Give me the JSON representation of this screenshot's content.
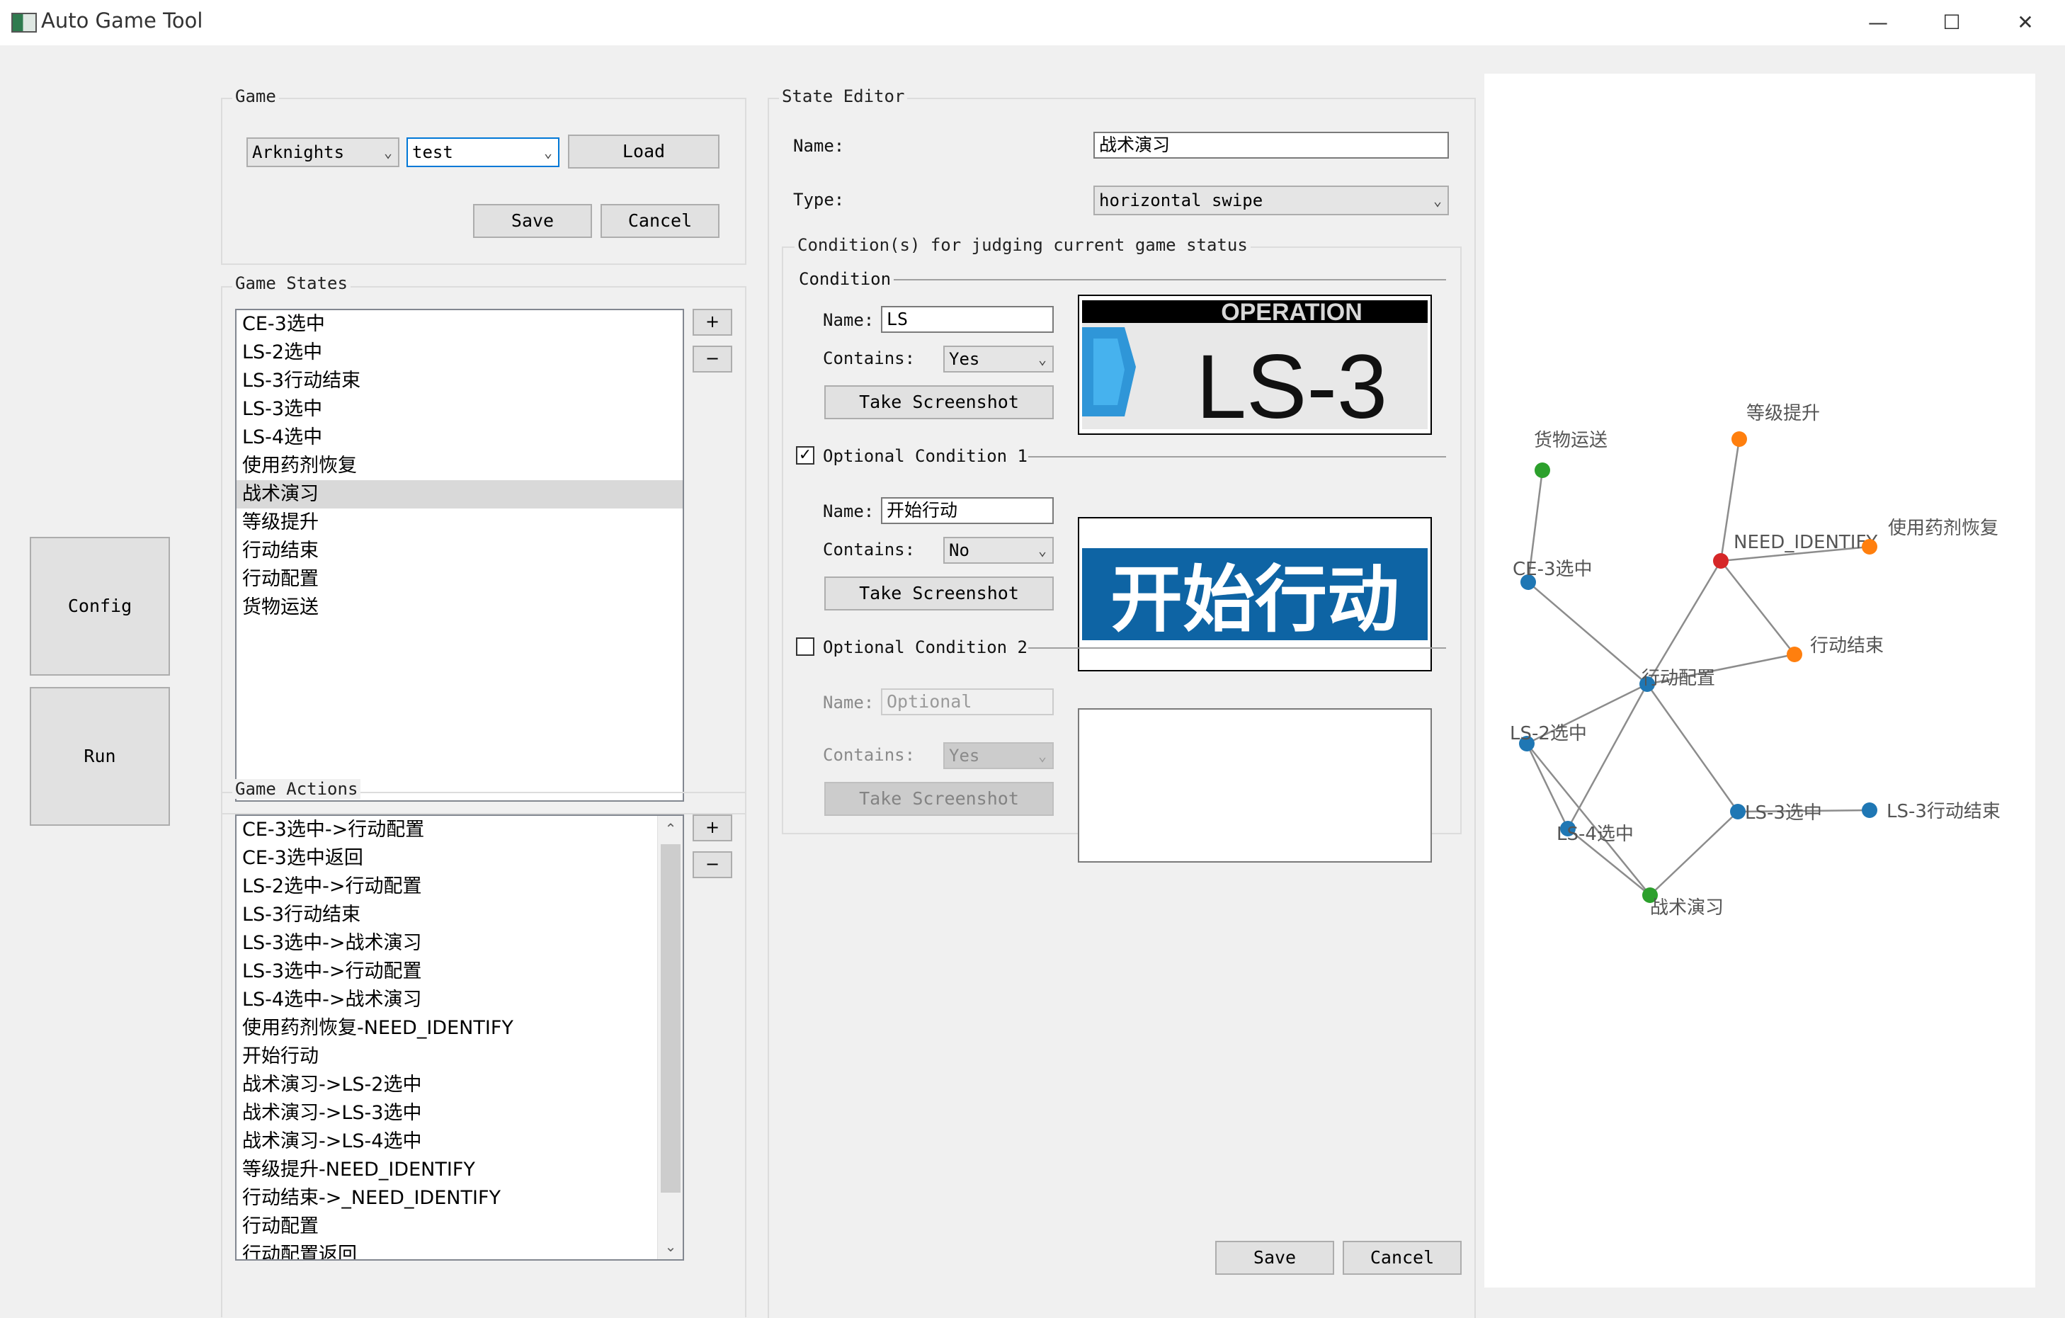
{
  "window": {
    "title": "Auto Game Tool",
    "minimize_glyph": "—",
    "maximize_glyph": "☐",
    "close_glyph": "✕"
  },
  "sidebar": {
    "config_label": "Config",
    "run_label": "Run"
  },
  "game_group": {
    "title": "Game",
    "game_select": "Arknights",
    "profile_select": "test",
    "load_label": "Load",
    "save_label": "Save",
    "cancel_label": "Cancel"
  },
  "states_group": {
    "title": "Game States",
    "add_label": "+",
    "remove_label": "−",
    "selected_index": 6,
    "items": [
      "CE-3选中",
      "LS-2选中",
      "LS-3行动结束",
      "LS-3选中",
      "LS-4选中",
      "使用药剂恢复",
      "战术演习",
      "等级提升",
      "行动结束",
      "行动配置",
      "货物运送"
    ]
  },
  "actions_group": {
    "title": "Game Actions",
    "add_label": "+",
    "remove_label": "−",
    "items": [
      "CE-3选中->行动配置",
      "CE-3选中返回",
      "LS-2选中->行动配置",
      "LS-3行动结束",
      "LS-3选中->战术演习",
      "LS-3选中->行动配置",
      "LS-4选中->战术演习",
      "使用药剂恢复-NEED_IDENTIFY",
      "开始行动",
      "战术演习->LS-2选中",
      "战术演习->LS-3选中",
      "战术演习->LS-4选中",
      "等级提升-NEED_IDENTIFY",
      "行动结束->_NEED_IDENTIFY",
      "行动配置",
      "行动配置返回"
    ]
  },
  "state_editor": {
    "title": "State Editor",
    "name_label": "Name:",
    "name_value": "战术演习",
    "type_label": "Type:",
    "type_value": "horizontal swipe",
    "conditions_title": "Condition(s) for judging current game status",
    "save_label": "Save",
    "cancel_label": "Cancel",
    "condition": {
      "title": "Condition",
      "name_label": "Name:",
      "name_value": "LS",
      "contains_label": "Contains:",
      "contains_value": "Yes",
      "screenshot_label": "Take Screenshot",
      "image_banner": "OPERATION",
      "image_text": "LS-3"
    },
    "optional1": {
      "title": "Optional Condition 1",
      "checked": true,
      "check_glyph": "✓",
      "name_label": "Name:",
      "name_value": "开始行动",
      "contains_label": "Contains:",
      "contains_value": "No",
      "screenshot_label": "Take Screenshot",
      "image_text": "开始行动"
    },
    "optional2": {
      "title": "Optional Condition 2",
      "checked": false,
      "name_label": "Name:",
      "name_placeholder": "Optional",
      "contains_label": "Contains:",
      "contains_value": "Yes",
      "screenshot_label": "Take Screenshot"
    }
  },
  "graph": {
    "colors": {
      "blue": "#1f77b4",
      "orange": "#ff7f0e",
      "green": "#2ca02c",
      "red": "#d62728",
      "edge": "#8c8c8c",
      "label": "#555555"
    },
    "nodes": [
      {
        "id": "货物运送",
        "label": "货物运送",
        "color": "green"
      },
      {
        "id": "等级提升",
        "label": "等级提升",
        "color": "orange"
      },
      {
        "id": "NEED_IDENTIFY",
        "label": "NEED_IDENTIFY",
        "color": "red"
      },
      {
        "id": "使用药剂恢复",
        "label": "使用药剂恢复",
        "color": "orange"
      },
      {
        "id": "CE-3选中",
        "label": "CE-3选中",
        "color": "blue"
      },
      {
        "id": "行动结束",
        "label": "行动结束",
        "color": "orange"
      },
      {
        "id": "行动配置",
        "label": "行动配置",
        "color": "blue"
      },
      {
        "id": "LS-2选中",
        "label": "LS-2选中",
        "color": "blue"
      },
      {
        "id": "LS-3选中",
        "label": "LS-3选中",
        "color": "blue"
      },
      {
        "id": "LS-3行动结束",
        "label": "LS-3行动结束",
        "color": "blue"
      },
      {
        "id": "LS-4选中",
        "label": "LS-4选中",
        "color": "blue"
      },
      {
        "id": "战术演习",
        "label": "战术演习",
        "color": "green"
      }
    ],
    "edges": [
      [
        "货物运送",
        "CE-3选中"
      ],
      [
        "CE-3选中",
        "行动配置"
      ],
      [
        "等级提升",
        "NEED_IDENTIFY"
      ],
      [
        "NEED_IDENTIFY",
        "使用药剂恢复"
      ],
      [
        "NEED_IDENTIFY",
        "行动配置"
      ],
      [
        "NEED_IDENTIFY",
        "行动结束"
      ],
      [
        "行动结束",
        "行动配置"
      ],
      [
        "行动配置",
        "LS-2选中"
      ],
      [
        "行动配置",
        "LS-3选中"
      ],
      [
        "行动配置",
        "LS-4选中"
      ],
      [
        "LS-3选中",
        "LS-3行动结束"
      ],
      [
        "LS-3选中",
        "战术演习"
      ],
      [
        "LS-2选中",
        "战术演习"
      ],
      [
        "LS-4选中",
        "战术演习"
      ],
      [
        "LS-2选中",
        "LS-4选中"
      ]
    ]
  }
}
